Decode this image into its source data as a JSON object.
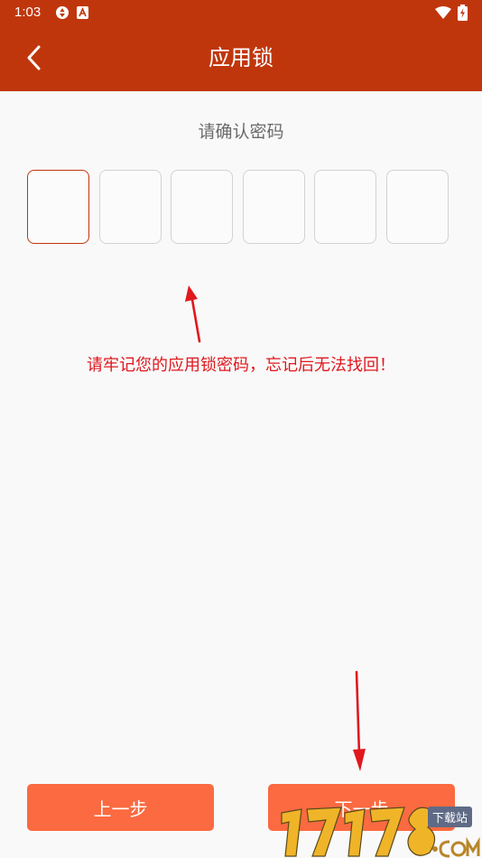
{
  "status_bar": {
    "time": "1:03",
    "icons": [
      "aperture-icon",
      "a-badge-icon",
      "wifi-icon",
      "battery-charging-icon"
    ]
  },
  "header": {
    "back_icon": "chevron-left-icon",
    "title": "应用锁",
    "background": "#c0360c"
  },
  "passcode": {
    "prompt": "请确认密码",
    "length": 6,
    "filled": 0,
    "active_index": 0,
    "active_color": "#c0360c"
  },
  "annotation": {
    "text": "请牢记您的应用锁密码，忘记后无法找回！",
    "color": "#e0181d"
  },
  "buttons": {
    "prev_label": "上一步",
    "next_label": "下一步",
    "color": "#fb6a40"
  },
  "watermark": {
    "logo_text": "17173.COM",
    "tag": "下载站"
  }
}
